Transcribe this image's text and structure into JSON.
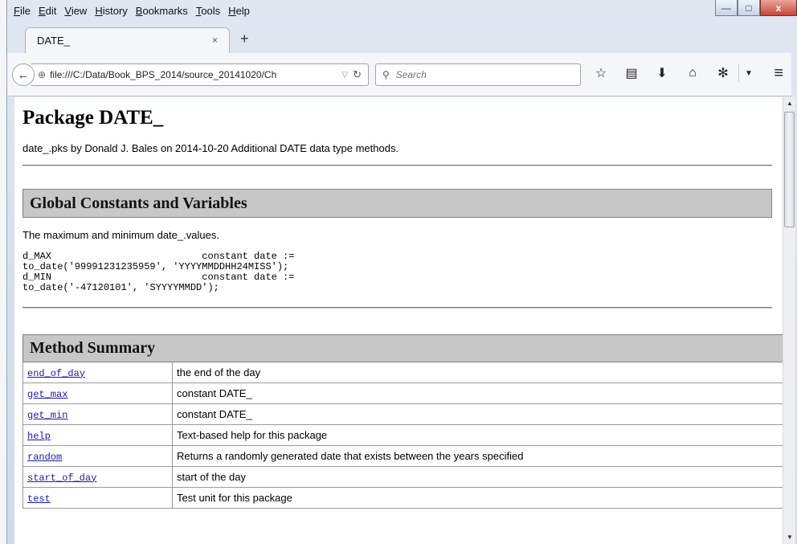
{
  "menu": [
    "File",
    "Edit",
    "View",
    "History",
    "Bookmarks",
    "Tools",
    "Help"
  ],
  "window_controls": {
    "minimize": "—",
    "maximize": "□",
    "close": "x"
  },
  "tab": {
    "title": "DATE_",
    "close": "×",
    "new_tab": "+"
  },
  "nav": {
    "back": "←",
    "url": "file:///C:/Data/Book_BPS_2014/source_20141020/Ch",
    "search_placeholder": "Search"
  },
  "page": {
    "title": "Package DATE_",
    "description": "date_.pks by Donald J. Bales on 2014-10-20 Additional DATE data type methods.",
    "globals": {
      "heading": "Global Constants and Variables",
      "note": "The maximum and minimum date_.values.",
      "code": "d_MAX                          constant date :=\nto_date('99991231235959', 'YYYYMMDDHH24MISS');\nd_MIN                          constant date :=\nto_date('-47120101', 'SYYYYMMDD');"
    },
    "methods": {
      "heading": "Method Summary",
      "rows": [
        {
          "name": "end_of_day",
          "desc": "the end of the day"
        },
        {
          "name": "get_max",
          "desc": "constant DATE_"
        },
        {
          "name": "get_min",
          "desc": "constant DATE_"
        },
        {
          "name": "help",
          "desc": "Text-based help for this package"
        },
        {
          "name": "random",
          "desc": "Returns a randomly generated date that exists between the years specified"
        },
        {
          "name": "start_of_day",
          "desc": "start of the day"
        },
        {
          "name": "test",
          "desc": "Test unit for this package"
        }
      ]
    }
  }
}
